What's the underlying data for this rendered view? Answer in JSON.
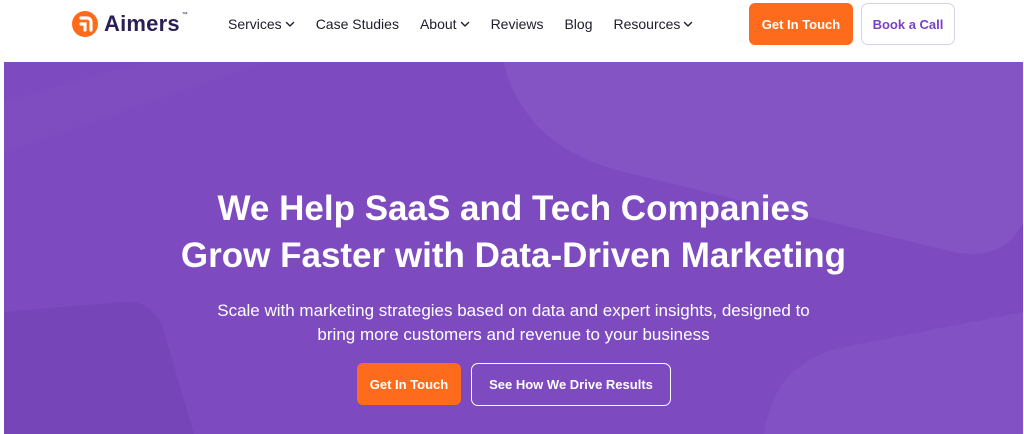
{
  "brand": {
    "name": "Aimers",
    "trademark": "™",
    "logo_color": "#ff6b1a"
  },
  "nav": {
    "items": [
      {
        "label": "Services",
        "has_dropdown": true
      },
      {
        "label": "Case Studies",
        "has_dropdown": false
      },
      {
        "label": "About",
        "has_dropdown": true
      },
      {
        "label": "Reviews",
        "has_dropdown": false
      },
      {
        "label": "Blog",
        "has_dropdown": false
      },
      {
        "label": "Resources",
        "has_dropdown": true
      }
    ],
    "cta_primary": "Get In Touch",
    "cta_secondary": "Book a Call"
  },
  "hero": {
    "title_line1": "We Help SaaS and Tech Companies",
    "title_line2": "Grow Faster with Data-Driven Marketing",
    "subtitle_line1": "Scale with marketing strategies based on data and expert insights, designed to",
    "subtitle_line2": "bring more customers and revenue to your business",
    "cta_primary": "Get In Touch",
    "cta_secondary": "See How We Drive Results"
  },
  "colors": {
    "accent_orange": "#fe6b1c",
    "hero_purple": "#7d4bbf",
    "brand_purple_text": "#7b3fc4",
    "logo_text": "#2b1f55"
  },
  "icons": {
    "logo": "aimers-logo-icon",
    "dropdown": "chevron-down-icon"
  }
}
